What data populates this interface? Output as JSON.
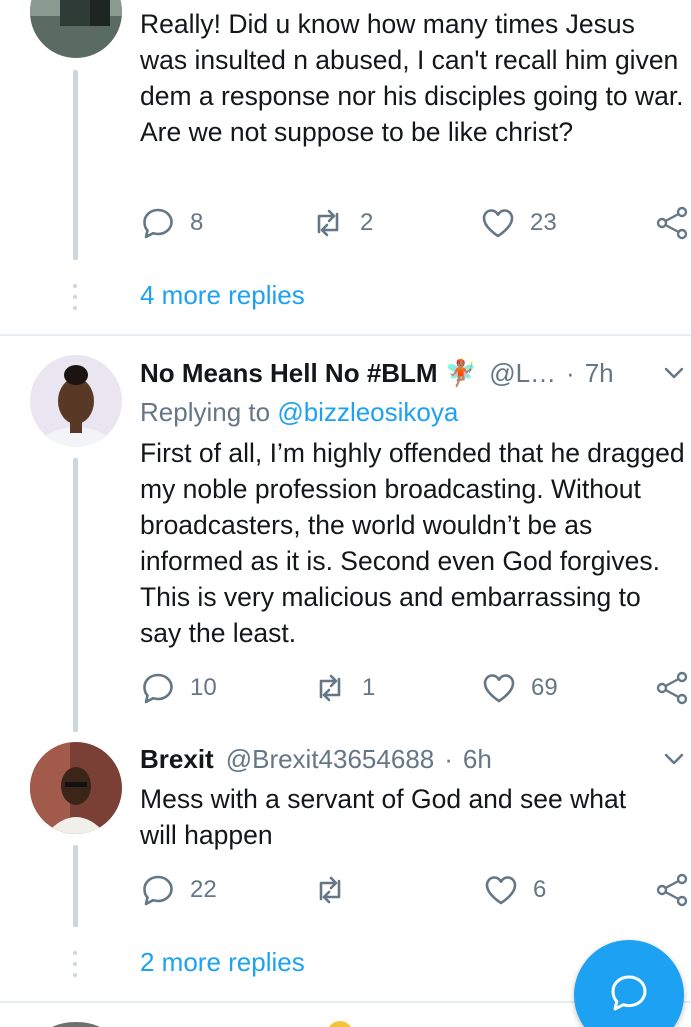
{
  "tweets": [
    {
      "text": "Really! Did u know how many times Jesus was insulted n abused, I can't recall him given dem a response nor his disciples going to war. Are we not suppose to be like christ?",
      "replies": "8",
      "retweets": "2",
      "likes": "23",
      "more_replies": "4 more replies"
    },
    {
      "name": "No Means Hell No #BLM 🧚🏽",
      "handle": "@L…",
      "time": "7h",
      "replying_prefix": "Replying to",
      "replying_to": "@bizzleosikoya",
      "text": "First of all, I’m highly offended that he dragged my noble profession broadcasting. Without broadcasters, the world wouldn’t be as informed as it is. Second even God forgives. This is very malicious and embarrassing to say the least.",
      "replies": "10",
      "retweets": "1",
      "likes": "69"
    },
    {
      "name": "Brexit",
      "handle": "@Brexit43654688",
      "time": "6h",
      "text": "Mess with a servant of God and see what will happen",
      "replies": "22",
      "retweets": "",
      "likes": "6",
      "more_replies": "2 more replies"
    }
  ],
  "separator": "·",
  "icons": {
    "reply": "reply-icon",
    "retweet": "retweet-icon",
    "like": "heart-icon",
    "share": "share-icon",
    "menu": "chevron-down-icon",
    "compose": "compose-reply-icon"
  },
  "colors": {
    "accent": "#1da1f2",
    "secondary_text": "#657786",
    "primary_text": "#14171a",
    "thread_line": "#ccd6dd"
  }
}
